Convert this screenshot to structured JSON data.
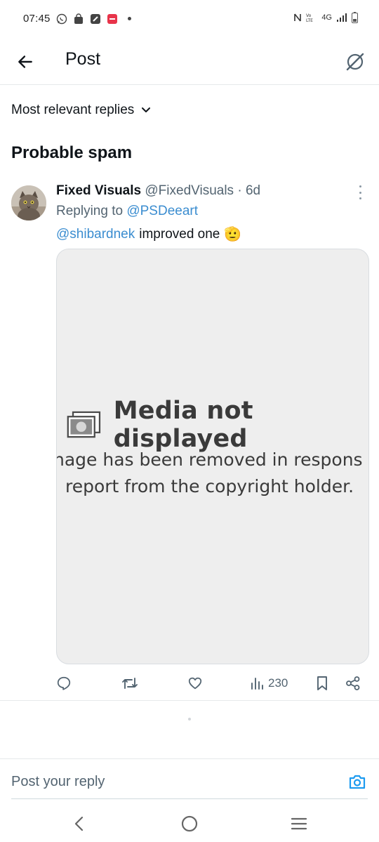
{
  "status_bar": {
    "time": "07:45",
    "network": "4G"
  },
  "header": {
    "title": "Post"
  },
  "sort": {
    "label": "Most relevant replies"
  },
  "section": {
    "title": "Probable spam"
  },
  "post": {
    "author_name": "Fixed Visuals",
    "author_handle": "@FixedVisuals",
    "separator": "·",
    "time": "6d",
    "replying_prefix": "Replying to",
    "replying_to": "@PSDeeart",
    "text_mention": "@shibardnek",
    "text_body": "improved one",
    "emoji": "🫡",
    "media": {
      "title": "Media not displayed",
      "desc_line1": "nage has been removed in respons",
      "desc_line2": "report from the copyright holder."
    },
    "views": "230"
  },
  "reply_box": {
    "placeholder": "Post your reply"
  },
  "colors": {
    "accent": "#1d9bf0",
    "text": "#0f1419",
    "secondary": "#536471"
  }
}
